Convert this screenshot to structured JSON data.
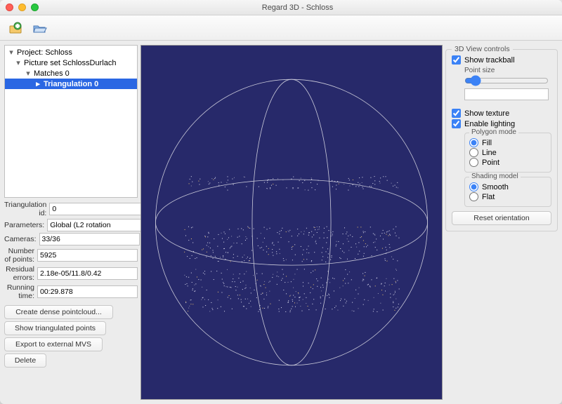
{
  "window": {
    "title": "Regard 3D - Schloss"
  },
  "tree": {
    "root": "Project: Schloss",
    "picset": "Picture set SchlossDurlach",
    "matches": "Matches 0",
    "triangulation": "Triangulation 0"
  },
  "props": {
    "id_label": "Triangulation id:",
    "id_val": "0",
    "params_label": "Parameters:",
    "params_val": "Global (L2 rotation",
    "cameras_label": "Cameras:",
    "cameras_val": "33/36",
    "npoints_label": "Number of points:",
    "npoints_val": "5925",
    "resid_label": "Residual errors:",
    "resid_val": "2.18e-05/11.8/0.42",
    "rtime_label": "Running time:",
    "rtime_val": "00:29.878"
  },
  "buttons": {
    "dense": "Create dense pointcloud...",
    "showtri": "Show triangulated points",
    "export": "Export to external MVS",
    "delete": "Delete",
    "reset": "Reset orientation"
  },
  "controls": {
    "title": "3D View controls",
    "trackball": "Show trackball",
    "pointsize": "Point size",
    "texture": "Show texture",
    "lighting": "Enable lighting",
    "polymode": "Polygon mode",
    "fill": "Fill",
    "line": "Line",
    "point": "Point",
    "shading": "Shading model",
    "smooth": "Smooth",
    "flat": "Flat"
  }
}
